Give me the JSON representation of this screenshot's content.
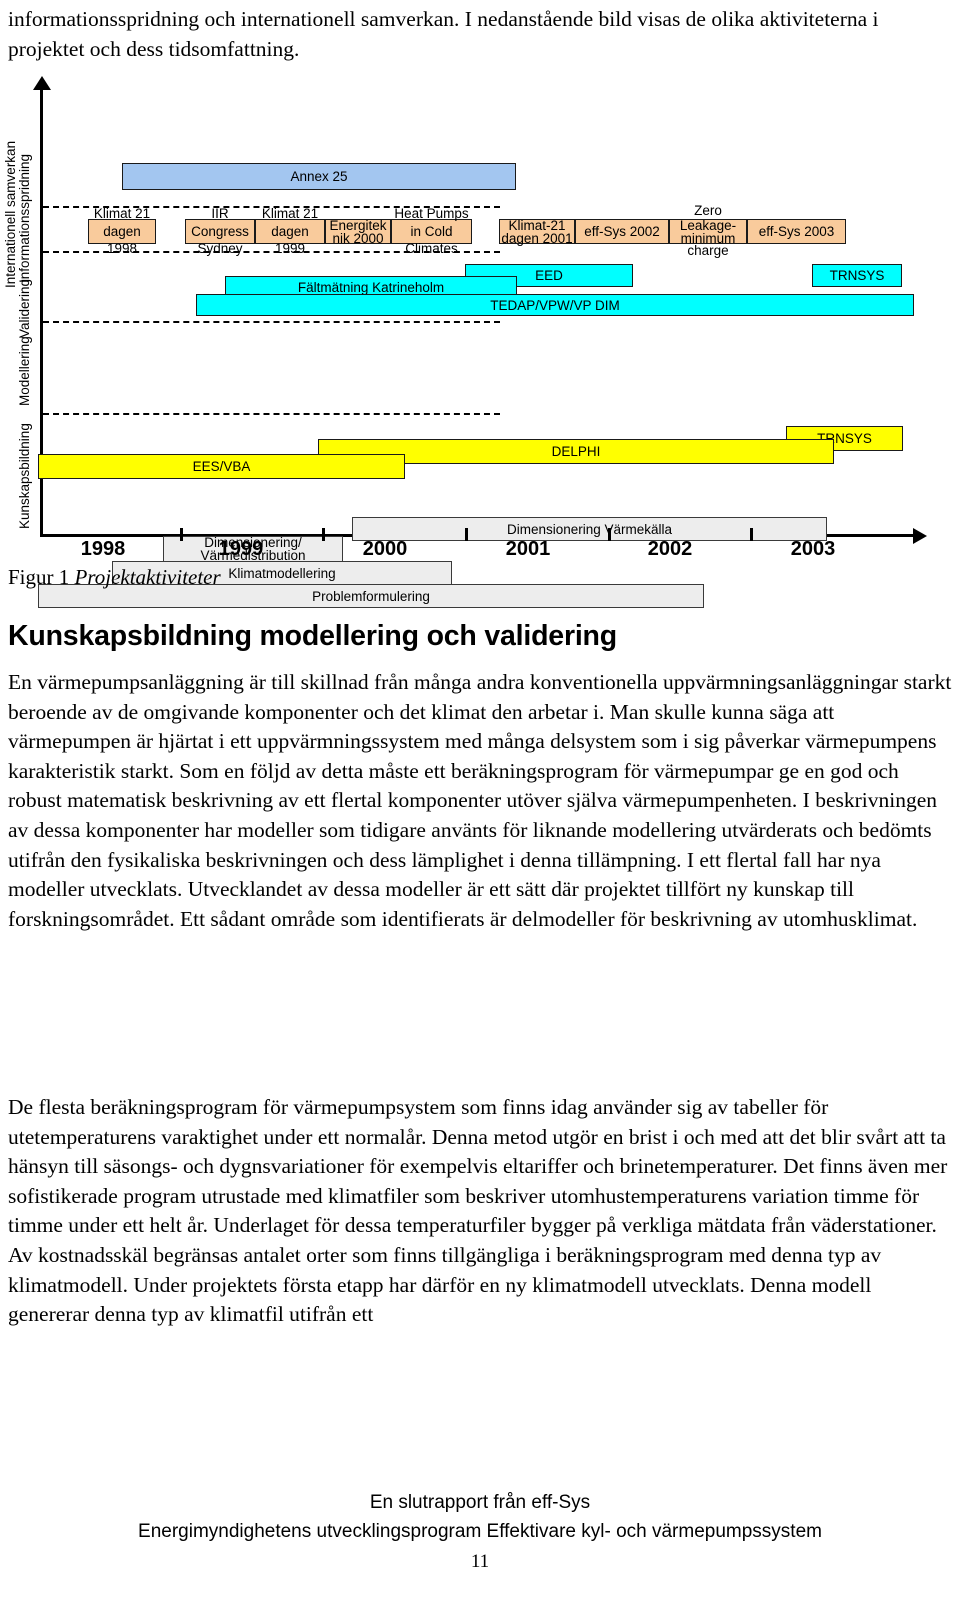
{
  "intro": {
    "text": "informationsspridning och internationell samverkan. I nedanstående bild visas de olika aktiviteterna i projektet och dess tidsomfattning."
  },
  "figure": {
    "caption_label": "Figur 1",
    "caption_title": "Projektaktiviteter",
    "axis_labels": [
      "Informationsspridning",
      "Internationell samverkan",
      "Validering",
      "Modellering",
      "Kunskapsbildning"
    ],
    "years": [
      "1998",
      "1999",
      "2000",
      "2001",
      "2002",
      "2003"
    ],
    "colors": {
      "dissemination": "#a3c6f0",
      "events": "#f9cb9c",
      "validation": "#00ffff",
      "modelling": "#ffff00",
      "knowledge": "#ededed"
    },
    "bars": {
      "annex25": "Annex 25",
      "klimat21_1998": "Klimat 21 dagen 1998",
      "iir_congress": "IIR Congress Sydney",
      "klimat21_1999": "Klimat 21 dagen 1999",
      "energiteknik": "Energiteknik 2000",
      "heatpumps": "Heat Pumps in Cold Climates",
      "klimat21_2001": "Klimat-21 dagen 2001",
      "effsys2002": "eff-Sys 2002",
      "zero_leakage": "Zero Leakage-minimum charge",
      "effsys2003": "eff-Sys 2003",
      "faltmatning": "Fältmätning Katrineholm",
      "eed": "EED",
      "tedap": "TEDAP/VPW/VP DIM",
      "trnsys_cyan": "TRNSYS",
      "ees_vba": "EES/VBA",
      "delphi": "DELPHI",
      "trnsys_yellow": "TRNSYS",
      "dimensionering_varme": "Dimensionering/ Värmedistribution",
      "klimatmodellering": "Klimatmodellering",
      "dim_varmekalla": "Dimensionering Värmekälla",
      "problemformulering": "Problemformulering"
    },
    "bar_text_parts": {
      "klimat21_1998_top": "Klimat 21",
      "klimat21_1998_mid": "dagen",
      "klimat21_1998_bot": "1998",
      "iir_top": "IIR",
      "iir_mid": "Congress",
      "iir_bot": "Sydney",
      "klimat21_1999_top": "Klimat 21",
      "klimat21_1999_mid": "dagen",
      "klimat21_1999_bot": "1999",
      "energitek_l1": "Energitek",
      "energitek_l2": "nik 2000",
      "heatpumps_top": "Heat Pumps",
      "heatpumps_mid": "in Cold",
      "heatpumps_bot": "Climates",
      "klimat2001_l1": "Klimat-21",
      "klimat2001_l2": "dagen 2001",
      "zero_top": "Zero",
      "zero_l1": "Leakage-",
      "zero_l2": "minimum",
      "zero_bot": "charge",
      "dim_l1": "Dimensionering/",
      "dim_l2": "Värmedistribution"
    }
  },
  "body": {
    "heading": "Kunskapsbildning modellering och validering",
    "paragraph1": "En värmepumpsanläggning är till skillnad från många andra konventionella uppvärmningsanläggningar starkt beroende av de omgivande komponenter och det klimat den arbetar i. Man skulle kunna säga att värmepumpen är hjärtat i ett uppvärmningssystem med många delsystem som i sig påverkar värmepumpens karakteristik starkt. Som en följd av detta måste ett beräkningsprogram för värmepumpar ge en god och robust matematisk beskrivning av ett flertal komponenter utöver själva värmepumpenheten. I beskrivningen av dessa komponenter har modeller som tidigare använts för liknande modellering utvärderats och bedömts utifrån den fysikaliska beskrivningen och dess lämplighet i denna tillämpning. I ett flertal fall har nya modeller utvecklats. Utvecklandet av dessa modeller är ett sätt där projektet tillfört ny kunskap till forskningsområdet. Ett sådant område som identifierats är delmodeller för beskrivning av utomhusklimat.",
    "paragraph2": "De flesta beräkningsprogram för värmepumpsystem som finns idag använder sig av tabeller för utetemperaturens varaktighet under ett normalår. Denna metod utgör en brist i och med att det blir svårt att ta hänsyn till säsongs- och dygnsvariationer för exempelvis eltariffer och brinetemperaturer. Det finns även mer sofistikerade program utrustade med klimatfiler som beskriver utomhustemperaturens variation timme för timme under ett helt år. Underlaget för dessa temperaturfiler bygger på verkliga mätdata från väderstationer. Av kostnadsskäl begränsas antalet orter som finns tillgängliga i beräkningsprogram med denna typ av klimatmodell. Under projektets första etapp har därför en ny klimatmodell utvecklats. Denna modell genererar denna typ av klimatfil utifrån ett"
  },
  "footer": {
    "line1": "En slutrapport från eff-Sys",
    "line2": "Energimyndighetens utvecklingsprogram Effektivare kyl- och värmepumpssystem",
    "page_number": "11"
  }
}
